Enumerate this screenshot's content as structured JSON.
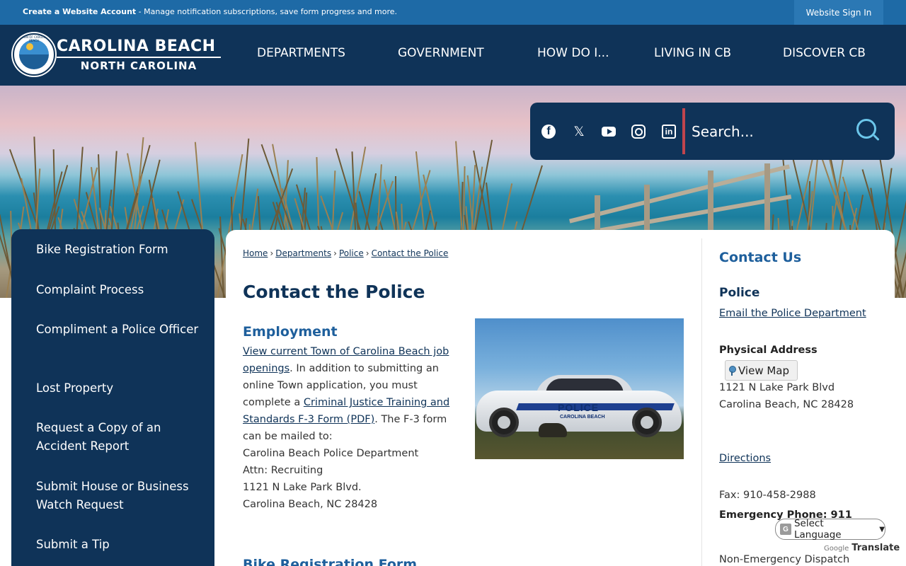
{
  "topbar": {
    "promo_bold": "Create a Website Account",
    "promo_rest": " - Manage notification subscriptions, save form progress and more.",
    "sign_in": "Website Sign In"
  },
  "header": {
    "logo_line1": "CAROLINA BEACH",
    "logo_line2": "NORTH CAROLINA",
    "seal_text": "TOWN OF CAROLINA BEACH",
    "nav": [
      "DEPARTMENTS",
      "GOVERNMENT",
      "HOW DO I...",
      "LIVING IN CB",
      "DISCOVER CB"
    ]
  },
  "search": {
    "placeholder": "Search..."
  },
  "social": {
    "facebook": "f",
    "x": "𝕏",
    "linkedin": "in"
  },
  "sidebar": {
    "items": [
      "Bike Registration Form",
      "Complaint Process",
      "Compliment a Police Officer",
      "Lost Property",
      "Request a Copy of an Accident Report",
      "Submit House or Business Watch Request",
      "Submit a Tip"
    ]
  },
  "breadcrumb": {
    "items": [
      "Home",
      "Departments",
      "Police",
      "Contact the Police"
    ],
    "separator": "›"
  },
  "main": {
    "title": "Contact the Police",
    "employment_heading": "Employment",
    "link_jobs": "View current Town of Carolina Beach job openings",
    "text1": ". In addition to submitting an online Town application, you must complete a ",
    "link_form": "Criminal Justice Training and Standards F-3 Form (PDF)",
    "text2": ". The F-3 form can be mailed to:",
    "addr1": "Carolina Beach Police Department",
    "addr2": "Attn: Recruiting",
    "addr3": "1121 N Lake Park Blvd.",
    "addr4": "Carolina Beach, NC 28428",
    "bike_heading": "Bike Registration Form",
    "photo_label": "POLICE",
    "photo_sublabel": "CAROLINA BEACH"
  },
  "contact": {
    "title": "Contact Us",
    "dept": "Police",
    "email_link": "Email the Police Department",
    "address_label": "Physical Address",
    "view_map": "View Map",
    "address1": "1121 N Lake Park Blvd",
    "address2": "Carolina Beach, NC 28428",
    "directions": "Directions",
    "fax": "Fax: 910-458-2988",
    "emergency": "Emergency Phone: 911",
    "non_emergency": "Non-Emergency Dispatch"
  },
  "translate": {
    "label": "Select Language",
    "powered_prefix": "Google",
    "powered": "Translate"
  },
  "colors": {
    "navy": "#0f3358",
    "topbar": "#1e6aa6",
    "heading_blue": "#1e5f9c",
    "search_accent": "#6cc6ea",
    "divider_red": "#c0454d"
  }
}
